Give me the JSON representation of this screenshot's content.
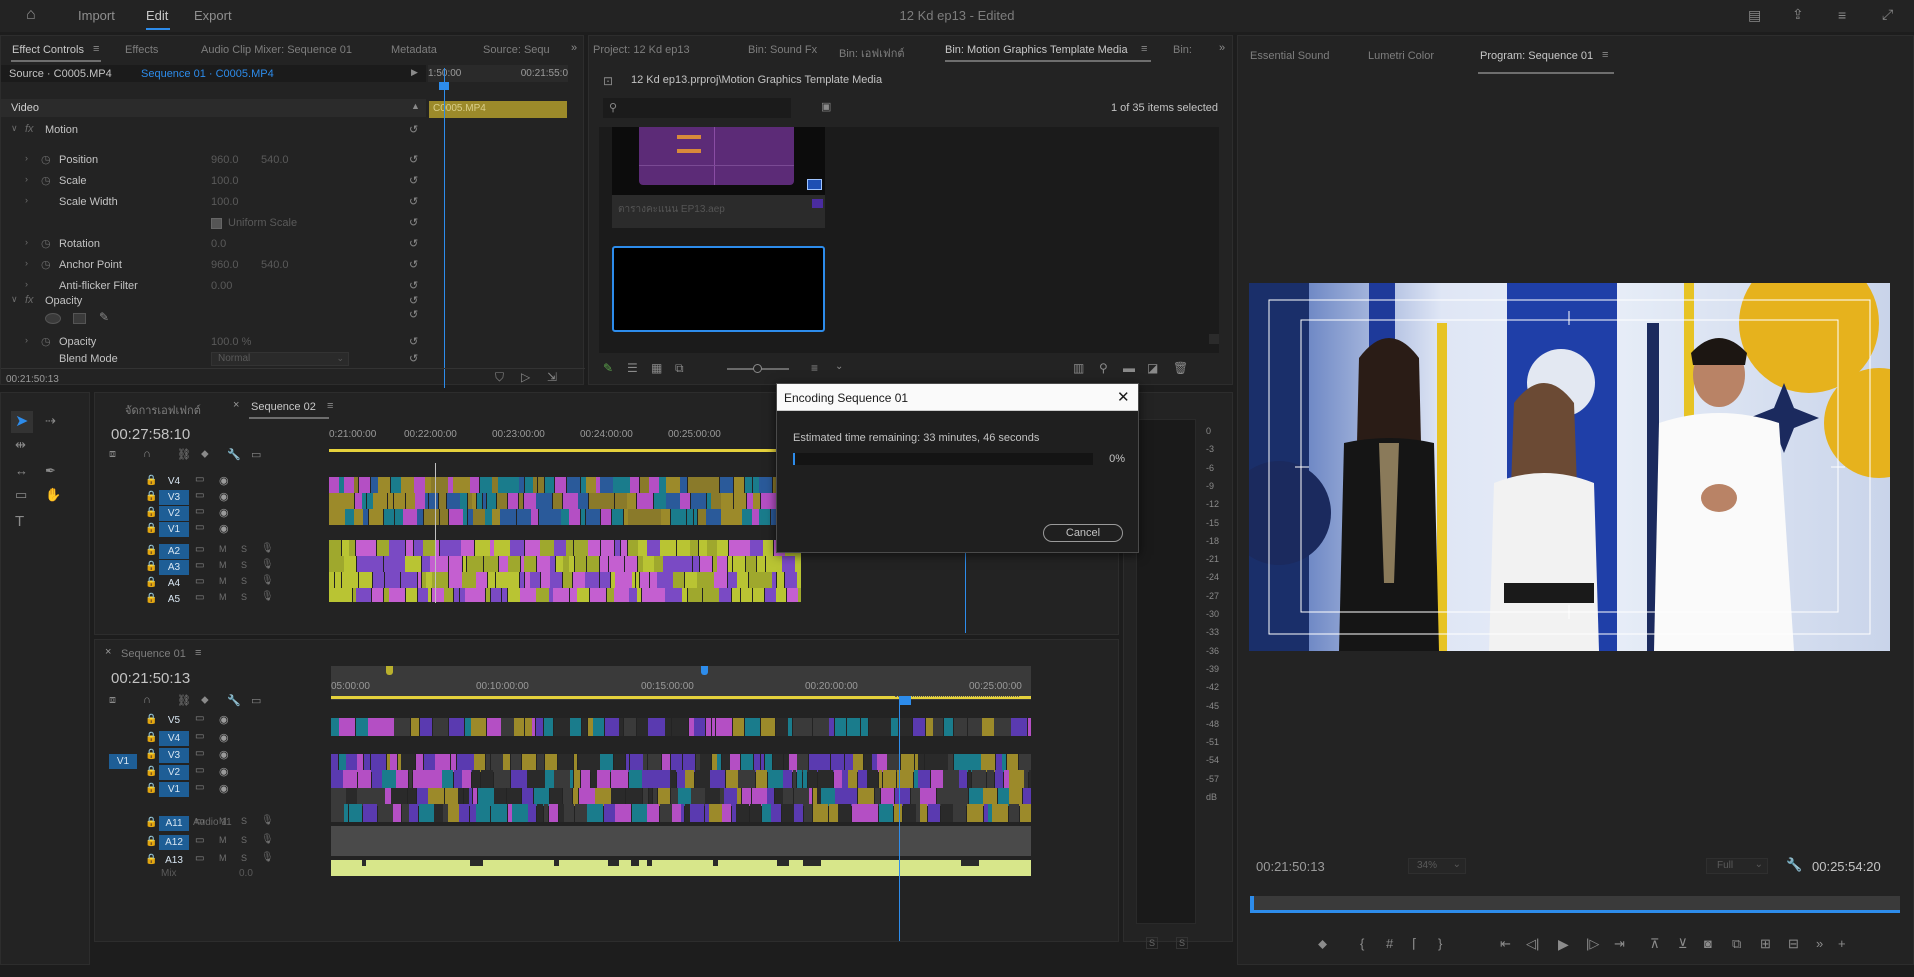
{
  "topbar": {
    "home": "home-icon",
    "import": "Import",
    "edit": "Edit",
    "export": "Export",
    "title": "12 Kd ep13 - Edited"
  },
  "effect_controls": {
    "tabs": [
      "Effect Controls",
      "Effects",
      "Audio Clip Mixer: Sequence 01",
      "Metadata",
      "Source: Sequ"
    ],
    "source": "Source · C0005.MP4",
    "sequence": "Sequence 01 · C0005.MP4",
    "ruler_start": "1:50:00",
    "ruler_end": "00:21:55:0",
    "clip": "C0005.MP4",
    "section": "Video",
    "motion": "Motion",
    "rows": [
      {
        "label": "Position",
        "v1": "960.0",
        "v2": "540.0"
      },
      {
        "label": "Scale",
        "v1": "100.0",
        "v2": ""
      },
      {
        "label": "Scale Width",
        "v1": "100.0",
        "v2": ""
      },
      {
        "label": "Uniform Scale",
        "v1": "",
        "v2": ""
      },
      {
        "label": "Rotation",
        "v1": "0.0",
        "v2": ""
      },
      {
        "label": "Anchor Point",
        "v1": "960.0",
        "v2": "540.0"
      },
      {
        "label": "Anti-flicker Filter",
        "v1": "0.00",
        "v2": ""
      }
    ],
    "opacity_section": "Opacity",
    "opacity_label": "Opacity",
    "opacity_value": "100.0 %",
    "blend_label": "Blend Mode",
    "blend_value": "Normal",
    "timecode": "00:21:50:13"
  },
  "project": {
    "tabs": [
      "Project: 12 Kd ep13",
      "Bin: Sound Fx",
      "Bin: เอฟเฟกต์",
      "Bin: Motion Graphics Template Media",
      "Bin:"
    ],
    "path": "12 Kd ep13.prproj\\Motion Graphics Template Media",
    "count": "1 of 35 items selected",
    "item_name": "ตารางคะแนน EP13.aep",
    "search_placeholder": ""
  },
  "program": {
    "tabs": [
      "Essential Sound",
      "Lumetri Color",
      "Program: Sequence 01"
    ],
    "timecode_left": "00:21:50:13",
    "zoom": "34%",
    "quality": "Full",
    "timecode_right": "00:25:54:20"
  },
  "timeline_top": {
    "tabs": [
      "จัดการเอฟเฟกต์",
      "Sequence 02"
    ],
    "timecode": "00:27:58:10",
    "ruler": [
      "0:21:00:00",
      "00:22:00:00",
      "00:23:00:00",
      "00:24:00:00",
      "00:25:00:00"
    ],
    "video_tracks": [
      "V4",
      "V3",
      "V2",
      "V1"
    ],
    "audio_tracks": [
      "A2",
      "A3",
      "A4",
      "A5"
    ]
  },
  "timeline_bottom": {
    "tab": "Sequence 01",
    "timecode": "00:21:50:13",
    "ruler": [
      "05:00:00",
      "00:10:00:00",
      "00:15:00:00",
      "00:20:00:00",
      "00:25:00:00"
    ],
    "video_tracks": [
      "V5",
      "V4",
      "V3",
      "V2",
      "V1"
    ],
    "source_patch": "V1",
    "audio_tracks": [
      "A11",
      "A12",
      "A13"
    ],
    "audio11_name": "Audio 11",
    "mix_label": "Mix",
    "mix_value": "0.0"
  },
  "meter": {
    "scale": [
      "0",
      "-3",
      "-6",
      "-9",
      "-12",
      "-15",
      "-18",
      "-21",
      "-24",
      "-27",
      "-30",
      "-33",
      "-36",
      "-39",
      "-42",
      "-45",
      "-48",
      "-51",
      "-54",
      "-57",
      "dB"
    ],
    "solo_left": "S",
    "solo_right": "S"
  },
  "dialog": {
    "title": "Encoding Sequence 01",
    "estimate": "Estimated time remaining: 33 minutes, 46 seconds",
    "percent": "0%",
    "progress": 0.005,
    "cancel": "Cancel"
  },
  "colors": {
    "accent": "#2d8ceb",
    "audio_green": "#b9c433",
    "video_magenta": "#b44fc4",
    "video_teal": "#1a7c8c",
    "selected_track": "#1e5e96"
  }
}
